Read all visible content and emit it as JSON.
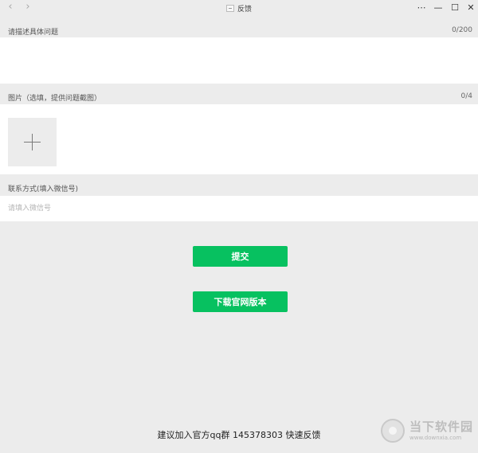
{
  "window": {
    "title": "反馈",
    "back_icon": "‹",
    "forward_icon": "›",
    "controls": [
      "⋯",
      "—",
      "☐",
      "✕"
    ]
  },
  "description": {
    "label": "请描述具体问题",
    "counter": "0/200",
    "value": ""
  },
  "images": {
    "label": "图片（选填，提供问题截图）",
    "counter": "0/4"
  },
  "contact": {
    "label": "联系方式(填入微信号)",
    "placeholder": "请填入微信号",
    "value": ""
  },
  "buttons": {
    "submit": "提交",
    "download": "下载官网版本"
  },
  "footer": {
    "text": "建议加入官方qq群 145378303 快速反馈"
  },
  "watermark": {
    "name": "当下软件园",
    "url": "www.downxia.com"
  },
  "colors": {
    "accent": "#07c160",
    "background": "#ececec",
    "panel": "#ffffff"
  }
}
